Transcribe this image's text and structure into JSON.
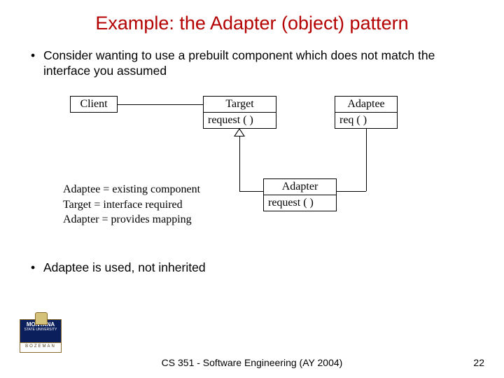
{
  "title": "Example: the Adapter (object) pattern",
  "bullets": {
    "b1": "Consider wanting to use a prebuilt component which does not match the interface you assumed",
    "b2": "Adaptee is used, not inherited"
  },
  "diagram": {
    "client": {
      "name": "Client"
    },
    "target": {
      "name": "Target",
      "op": "request ( )"
    },
    "adaptee": {
      "name": "Adaptee",
      "op": "req ( )"
    },
    "adapter": {
      "name": "Adapter",
      "op": "request ( )"
    },
    "legend": {
      "l1": "Adaptee = existing component",
      "l2": "Target = interface required",
      "l3": "Adapter = provides mapping"
    }
  },
  "footer": "CS 351 - Software Engineering (AY 2004)",
  "page": "22",
  "logo": {
    "line1": "MONTANA",
    "line2": "STATE UNIVERSITY",
    "sub": "BOZEMAN"
  }
}
